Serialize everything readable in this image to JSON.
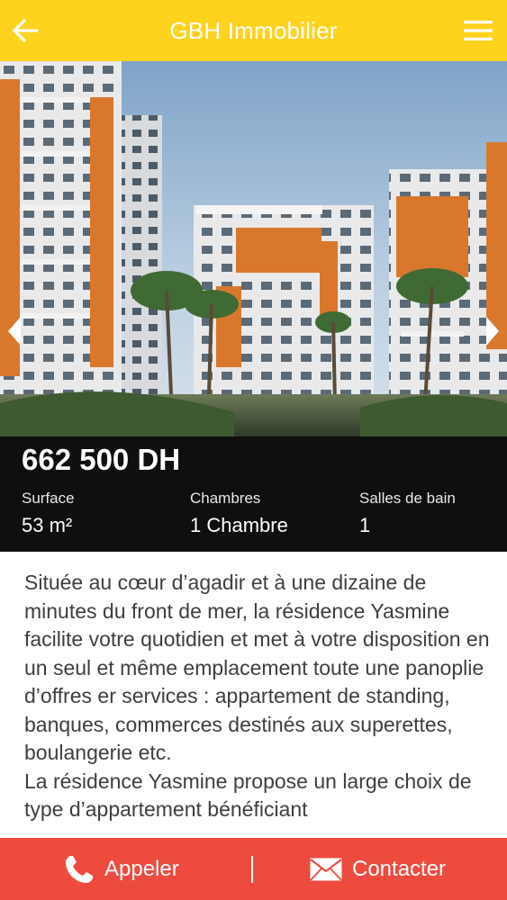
{
  "header": {
    "title": "GBH Immobilier",
    "back_icon": "arrow-left-icon",
    "menu_icon": "hamburger-menu-icon",
    "background": "#FFD21E"
  },
  "gallery": {
    "prev_icon": "chevron-left-icon",
    "next_icon": "chevron-right-icon"
  },
  "listing": {
    "price": "662 500 DH",
    "stats": [
      {
        "label": "Surface",
        "value": "53 m²"
      },
      {
        "label": "Chambres",
        "value": "1 Chambre"
      },
      {
        "label": "Salles de bain",
        "value": "1"
      }
    ],
    "description": [
      "Située au cœur d’agadir et à une dizaine de minutes du front de mer, la résidence Yasmine facilite votre quotidien et met à votre disposition en un seul et même emplacement toute une panoplie d’offres er services : appartement de standing, banques, commerces destinés aux superettes, boulangerie etc.",
      "La résidence Yasmine propose un large choix de type d’appartement bénéficiant"
    ]
  },
  "actions": {
    "call_label": "Appeler",
    "call_icon": "phone-icon",
    "contact_label": "Contacter",
    "contact_icon": "envelope-icon",
    "background": "#EE4B3F"
  }
}
